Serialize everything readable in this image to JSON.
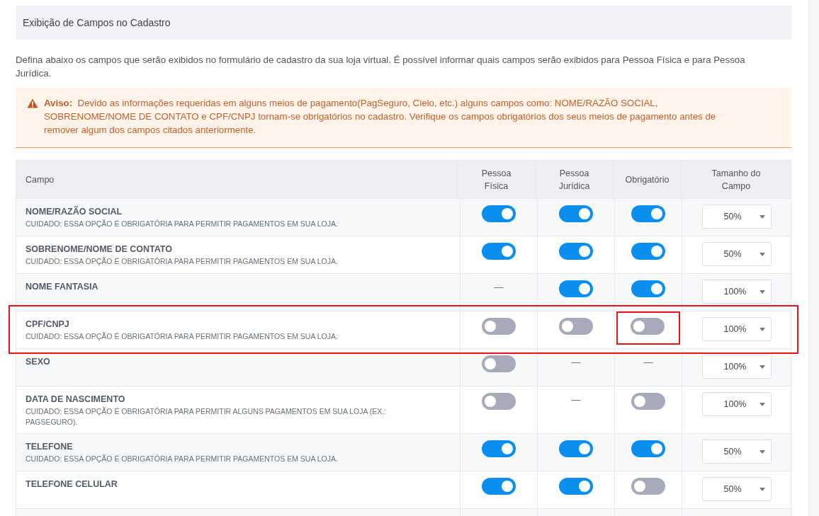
{
  "section_title": "Exibição de Campos no Cadastro",
  "description": "Defina abaixo os campos que serão exibidos no formulário de cadastro da sua loja virtual. É possível informar quais campos serão exibidos para Pessoa Física e para Pessoa Jurídica.",
  "warning": {
    "label": "Aviso:",
    "text": "Devido as informações requeridas em alguns meios de pagamento(PagSeguro, Cielo, etc.) alguns campos como: NOME/RAZÃO SOCIAL, SOBRENOME/NOME DE CONTATO e CPF/CNPJ tornam-se obrigatórios no cadastro. Verifique os campos obrigatórios dos seus meios de pagamento antes de remover algum dos campos citados anteriormente."
  },
  "table": {
    "columns": [
      "Campo",
      "Pessoa Física",
      "Pessoa Jurídica",
      "Obrigatório",
      "Tamanho do Campo"
    ],
    "rows": [
      {
        "highlighted": false,
        "cells": [
          {
            "kind": "field",
            "name": "NOME/RAZÃO SOCIAL",
            "note": "CUIDADO: ESSA OPÇÃO É OBRIGATÓRIA PARA PERMITIR PAGAMENTOS EM SUA LOJA."
          },
          {
            "kind": "toggle",
            "on": true,
            "highlighted": false
          },
          {
            "kind": "toggle",
            "on": true,
            "highlighted": false
          },
          {
            "kind": "toggle",
            "on": true,
            "highlighted": false
          },
          {
            "kind": "select",
            "value": "50%"
          }
        ]
      },
      {
        "highlighted": false,
        "cells": [
          {
            "kind": "field",
            "name": "SOBRENOME/NOME DE CONTATO",
            "note": "CUIDADO: ESSA OPÇÃO É OBRIGATÓRIA PARA PERMITIR PAGAMENTOS EM SUA LOJA."
          },
          {
            "kind": "toggle",
            "on": true,
            "highlighted": false
          },
          {
            "kind": "toggle",
            "on": true,
            "highlighted": false
          },
          {
            "kind": "toggle",
            "on": true,
            "highlighted": false
          },
          {
            "kind": "select",
            "value": "50%"
          }
        ]
      },
      {
        "highlighted": false,
        "cells": [
          {
            "kind": "field",
            "name": "NOME FANTASIA"
          },
          {
            "kind": "dash",
            "text": "—"
          },
          {
            "kind": "toggle",
            "on": true,
            "highlighted": false
          },
          {
            "kind": "toggle",
            "on": true,
            "highlighted": false
          },
          {
            "kind": "select",
            "value": "100%"
          }
        ]
      },
      {
        "highlighted": true,
        "cells": [
          {
            "kind": "field",
            "name": "CPF/CNPJ",
            "note": "CUIDADO: ESSA OPÇÃO É OBRIGATÓRIA PARA PERMITIR PAGAMENTOS EM SUA LOJA."
          },
          {
            "kind": "toggle",
            "on": false,
            "highlighted": false
          },
          {
            "kind": "toggle",
            "on": false,
            "highlighted": false
          },
          {
            "kind": "toggle",
            "on": false,
            "highlighted": true
          },
          {
            "kind": "select",
            "value": "100%"
          }
        ]
      },
      {
        "highlighted": false,
        "cells": [
          {
            "kind": "field",
            "name": "SEXO"
          },
          {
            "kind": "toggle",
            "on": false,
            "highlighted": false
          },
          {
            "kind": "dash",
            "text": "—"
          },
          {
            "kind": "dash",
            "text": "—"
          },
          {
            "kind": "select",
            "value": "100%"
          }
        ]
      },
      {
        "highlighted": false,
        "cells": [
          {
            "kind": "field",
            "name": "DATA DE NASCIMENTO",
            "note": "CUIDADO: ESSA OPÇÃO É OBRIGATÓRIA PARA PERMITIR ALGUNS PAGAMENTOS EM SUA LOJA (EX.: PAGSEGURO)."
          },
          {
            "kind": "toggle",
            "on": false,
            "highlighted": false
          },
          {
            "kind": "dash",
            "text": "—"
          },
          {
            "kind": "toggle",
            "on": false,
            "highlighted": false
          },
          {
            "kind": "select",
            "value": "100%"
          }
        ]
      },
      {
        "highlighted": false,
        "cells": [
          {
            "kind": "field",
            "name": "TELEFONE",
            "note": "CUIDADO: ESSA OPÇÃO É OBRIGATÓRIA PARA PERMITIR PAGAMENTOS EM SUA LOJA."
          },
          {
            "kind": "toggle",
            "on": true,
            "highlighted": false
          },
          {
            "kind": "toggle",
            "on": true,
            "highlighted": false
          },
          {
            "kind": "toggle",
            "on": true,
            "highlighted": false
          },
          {
            "kind": "select",
            "value": "50%"
          }
        ]
      },
      {
        "highlighted": false,
        "cells": [
          {
            "kind": "field",
            "name": "TELEFONE CELULAR"
          },
          {
            "kind": "toggle",
            "on": true,
            "highlighted": false
          },
          {
            "kind": "toggle",
            "on": true,
            "highlighted": false
          },
          {
            "kind": "toggle",
            "on": false,
            "highlighted": false
          },
          {
            "kind": "select",
            "value": "50%"
          }
        ]
      }
    ]
  }
}
